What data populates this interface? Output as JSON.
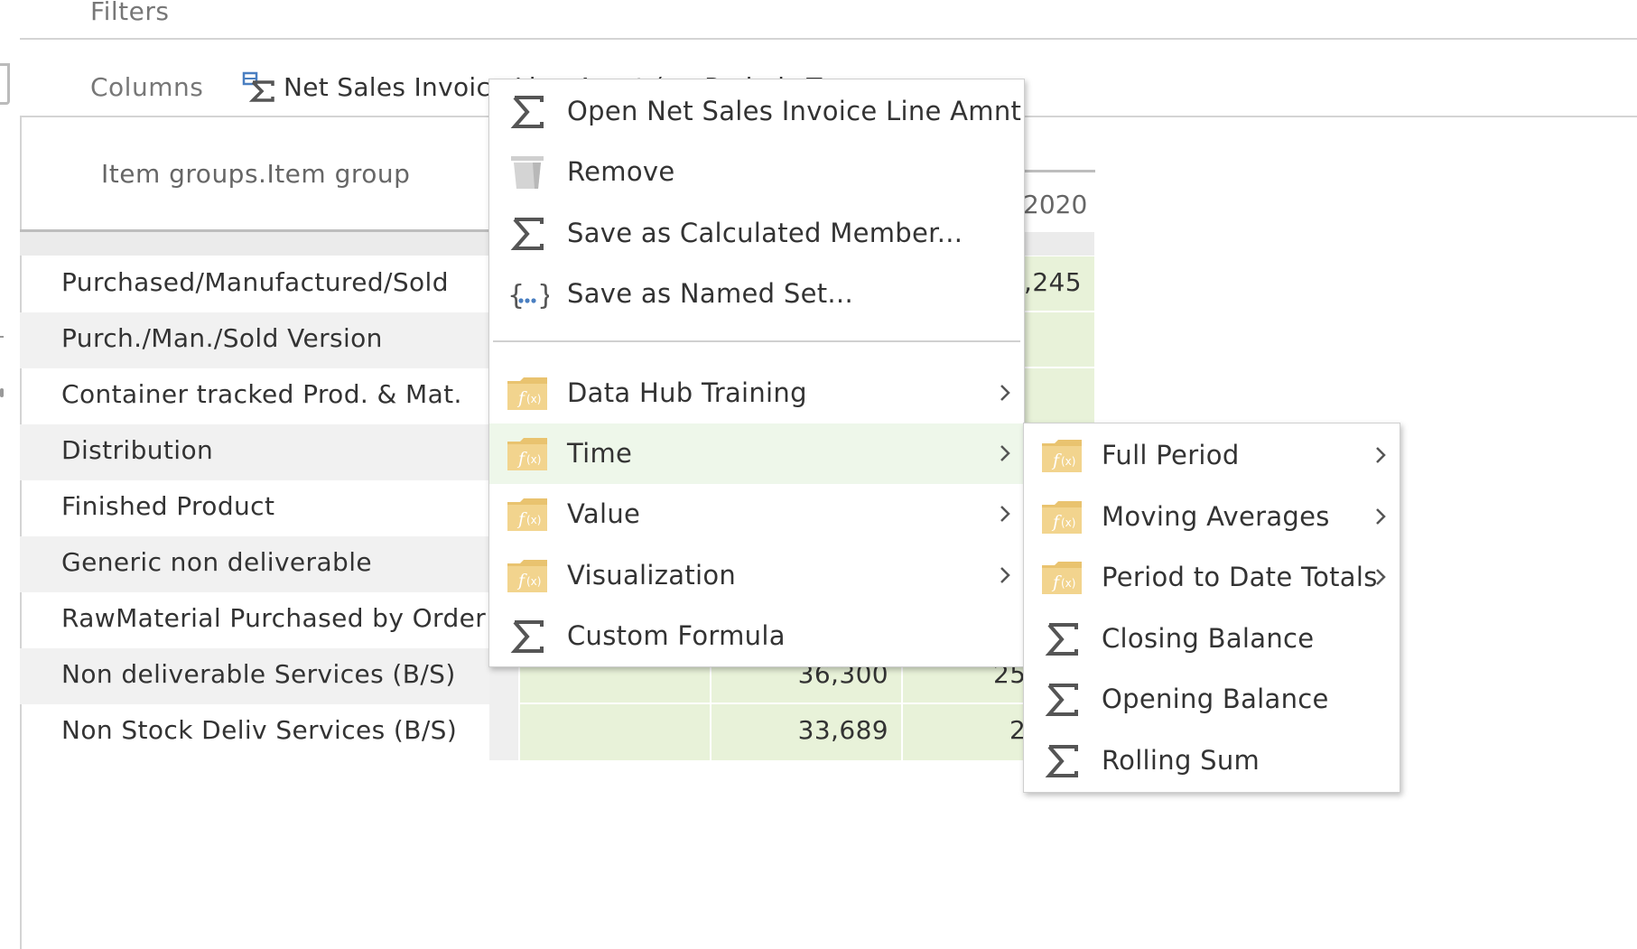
{
  "toolbar": {
    "filters_label": "Filters",
    "columns_label": "Columns",
    "column_chip": "Net Sales Invoice Line Amnt (on Periods T..."
  },
  "grid": {
    "row_header": "Item groups.Item group",
    "col_year": "2020",
    "rows": [
      {
        "label": "Purchased/Manufactured/Sold",
        "a": "",
        "b": ",245"
      },
      {
        "label": "Purch./Man./Sold Version",
        "a": "",
        "b": ""
      },
      {
        "label": "Container tracked Prod. & Mat.",
        "a": "",
        "b": ""
      },
      {
        "label": "Distribution",
        "a": "",
        "b": ""
      },
      {
        "label": "Finished Product",
        "a": "",
        "b": ""
      },
      {
        "label": "Generic non deliverable",
        "a": "",
        "b": ""
      },
      {
        "label": "RawMaterial Purchased by Order",
        "a": "",
        "b": ""
      },
      {
        "label": "Non deliverable Services (B/S)",
        "a": "36,300",
        "b": "25"
      },
      {
        "label": "Non Stock Deliv Services (B/S)",
        "a": "33,689",
        "b": "2"
      }
    ]
  },
  "context_menu": {
    "items": [
      {
        "label": "Open Net Sales Invoice Line Amnt",
        "icon": "sigma-icon"
      },
      {
        "label": "Remove",
        "icon": "trash-icon"
      },
      {
        "label": "Save as Calculated Member...",
        "icon": "sigma-icon"
      },
      {
        "label": "Save as Named Set...",
        "icon": "named-set-icon"
      },
      {
        "label": "Data Hub Training",
        "icon": "function-folder-icon",
        "submenu": true
      },
      {
        "label": "Time",
        "icon": "function-folder-icon",
        "submenu": true,
        "highlighted": true
      },
      {
        "label": "Value",
        "icon": "function-folder-icon",
        "submenu": true
      },
      {
        "label": "Visualization",
        "icon": "function-folder-icon",
        "submenu": true
      },
      {
        "label": "Custom Formula",
        "icon": "sigma-icon"
      }
    ]
  },
  "submenu_time": {
    "items": [
      {
        "label": "Full Period",
        "icon": "function-folder-icon",
        "submenu": true
      },
      {
        "label": "Moving Averages",
        "icon": "function-folder-icon",
        "submenu": true
      },
      {
        "label": "Period to Date Totals",
        "icon": "function-folder-icon",
        "submenu": true
      },
      {
        "label": "Closing Balance",
        "icon": "sigma-icon"
      },
      {
        "label": "Opening Balance",
        "icon": "sigma-icon"
      },
      {
        "label": "Rolling Sum",
        "icon": "sigma-icon"
      }
    ]
  },
  "colors": {
    "cell_green": "#e8f2d9",
    "highlight": "#eef7ea",
    "folder_gold": "#e9c36f",
    "sigma_gray": "#555555"
  }
}
